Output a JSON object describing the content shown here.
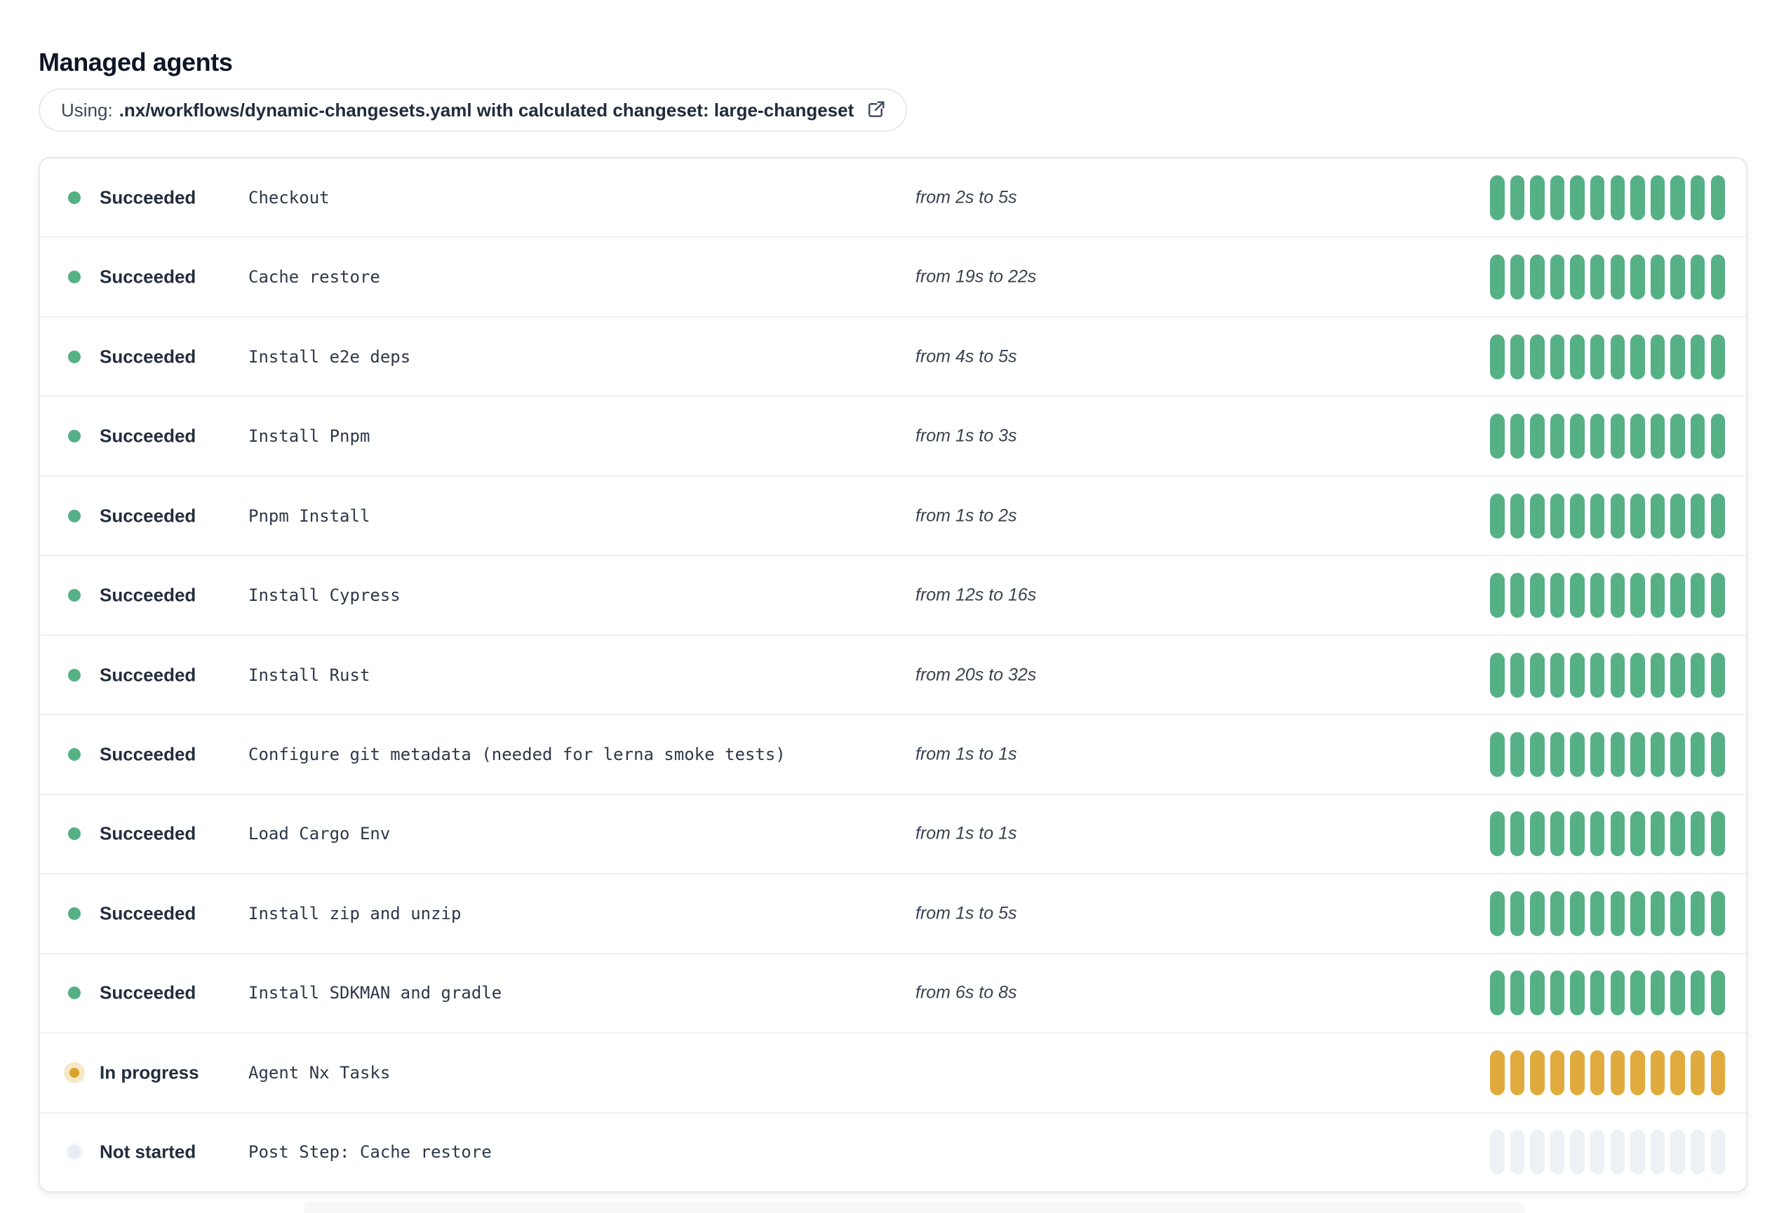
{
  "page": {
    "title": "Managed agents"
  },
  "workflow_banner": {
    "prefix": "Using:",
    "path_bold": ".nx/workflows/dynamic-changesets.yaml with calculated changeset: large-changeset",
    "icon": "external-link-icon"
  },
  "colors": {
    "succeeded": "#55b185",
    "in_progress": "#e0ab3c",
    "in_progress_dot": "#d9a228",
    "in_progress_halo": "#f5e8c6",
    "not_started": "#edf1f6",
    "not_started_dot": "#e7ecf2"
  },
  "agents": {
    "segments_per_bar": 12,
    "rows": [
      {
        "state": "succeeded",
        "status": "Succeeded",
        "step": "Checkout",
        "duration": "from 2s to 5s"
      },
      {
        "state": "succeeded",
        "status": "Succeeded",
        "step": "Cache restore",
        "duration": "from 19s to 22s"
      },
      {
        "state": "succeeded",
        "status": "Succeeded",
        "step": "Install e2e deps",
        "duration": "from 4s to 5s"
      },
      {
        "state": "succeeded",
        "status": "Succeeded",
        "step": "Install Pnpm",
        "duration": "from 1s to 3s"
      },
      {
        "state": "succeeded",
        "status": "Succeeded",
        "step": "Pnpm Install",
        "duration": "from 1s to 2s"
      },
      {
        "state": "succeeded",
        "status": "Succeeded",
        "step": "Install Cypress",
        "duration": "from 12s to 16s"
      },
      {
        "state": "succeeded",
        "status": "Succeeded",
        "step": "Install Rust",
        "duration": "from 20s to 32s"
      },
      {
        "state": "succeeded",
        "status": "Succeeded",
        "step": "Configure git metadata (needed for lerna smoke tests)",
        "duration": "from 1s to 1s"
      },
      {
        "state": "succeeded",
        "status": "Succeeded",
        "step": "Load Cargo Env",
        "duration": "from 1s to 1s"
      },
      {
        "state": "succeeded",
        "status": "Succeeded",
        "step": "Install zip and unzip",
        "duration": "from 1s to 5s"
      },
      {
        "state": "succeeded",
        "status": "Succeeded",
        "step": "Install SDKMAN and gradle",
        "duration": "from 6s to 8s"
      },
      {
        "state": "in_progress",
        "status": "In progress",
        "step": "Agent Nx Tasks",
        "duration": ""
      },
      {
        "state": "not_started",
        "status": "Not started",
        "step": "Post Step: Cache restore",
        "duration": ""
      }
    ]
  }
}
